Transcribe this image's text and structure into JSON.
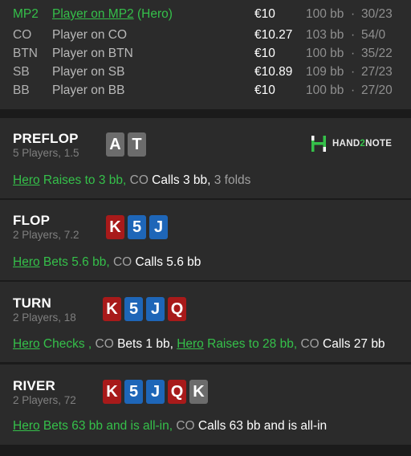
{
  "players": [
    {
      "position": "MP2",
      "name": "Player on MP2",
      "tag": "(Hero)",
      "money": "€10",
      "bb": "100 bb",
      "stats": "30/23",
      "hero": true
    },
    {
      "position": "CO",
      "name": "Player on CO",
      "money": "€10.27",
      "bb": "103 bb",
      "stats": "54/0",
      "hero": false
    },
    {
      "position": "BTN",
      "name": "Player on BTN",
      "money": "€10",
      "bb": "100 bb",
      "stats": "35/22",
      "hero": false
    },
    {
      "position": "SB",
      "name": "Player on SB",
      "money": "€10.89",
      "bb": "109 bb",
      "stats": "27/23",
      "hero": false
    },
    {
      "position": "BB",
      "name": "Player on BB",
      "money": "€10",
      "bb": "100 bb",
      "stats": "27/20",
      "hero": false
    }
  ],
  "separator": "·",
  "logo": {
    "brand_part1": "HAND",
    "brand_two": "2",
    "brand_part2": "NOTE",
    "color_accent": "#35c04a"
  },
  "streets": [
    {
      "title": "PREFLOP",
      "subtitle": "5 Players, 1.5",
      "cards": [
        {
          "rank": "A",
          "color": "grey"
        },
        {
          "rank": "T",
          "color": "grey"
        }
      ],
      "actions": [
        {
          "text": "Hero",
          "style": "hero-u"
        },
        {
          "text": " Raises to 3 bb,",
          "style": "hero"
        },
        {
          "text": " CO",
          "style": "pos"
        },
        {
          "text": " Calls 3 bb,",
          "style": "wht"
        },
        {
          "text": " 3 folds",
          "style": "pos"
        }
      ]
    },
    {
      "title": "FLOP",
      "subtitle": "2 Players, 7.2",
      "cards": [
        {
          "rank": "K",
          "color": "red"
        },
        {
          "rank": "5",
          "color": "blue"
        },
        {
          "rank": "J",
          "color": "blue"
        }
      ],
      "actions": [
        {
          "text": "Hero",
          "style": "hero-u"
        },
        {
          "text": " Bets 5.6 bb,",
          "style": "hero"
        },
        {
          "text": " CO",
          "style": "pos"
        },
        {
          "text": " Calls 5.6 bb",
          "style": "wht"
        }
      ]
    },
    {
      "title": "TURN",
      "subtitle": "2 Players, 18",
      "cards": [
        {
          "rank": "K",
          "color": "red"
        },
        {
          "rank": "5",
          "color": "blue"
        },
        {
          "rank": "J",
          "color": "blue"
        },
        {
          "rank": "Q",
          "color": "red"
        }
      ],
      "actions": [
        {
          "text": "Hero",
          "style": "hero-u"
        },
        {
          "text": " Checks ,",
          "style": "hero"
        },
        {
          "text": " CO",
          "style": "pos"
        },
        {
          "text": " Bets 1 bb,",
          "style": "wht"
        },
        {
          "text": " ",
          "style": "wht"
        },
        {
          "text": "Hero",
          "style": "hero-u"
        },
        {
          "text": " Raises to 28 bb,",
          "style": "hero"
        },
        {
          "text": " CO",
          "style": "pos"
        },
        {
          "text": " Calls 27 bb",
          "style": "wht"
        }
      ]
    },
    {
      "title": "RIVER",
      "subtitle": "2 Players, 72",
      "cards": [
        {
          "rank": "K",
          "color": "red"
        },
        {
          "rank": "5",
          "color": "blue"
        },
        {
          "rank": "J",
          "color": "blue"
        },
        {
          "rank": "Q",
          "color": "red"
        },
        {
          "rank": "K",
          "color": "grey"
        }
      ],
      "actions": [
        {
          "text": "Hero",
          "style": "hero-u"
        },
        {
          "text": " Bets 63 bb and is all-in,",
          "style": "hero"
        },
        {
          "text": " CO",
          "style": "pos"
        },
        {
          "text": " Calls 63 bb and is all-in",
          "style": "wht"
        }
      ]
    }
  ]
}
